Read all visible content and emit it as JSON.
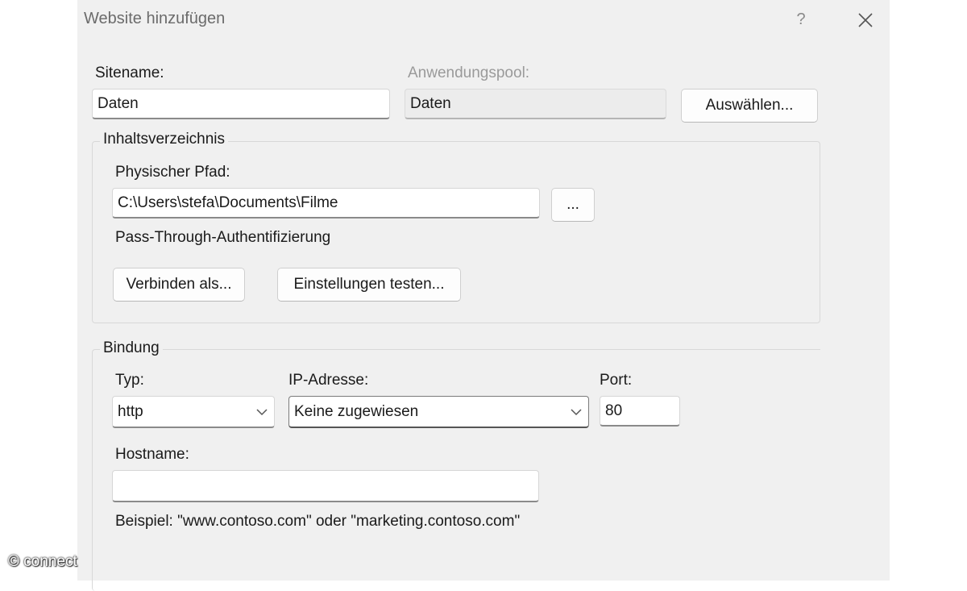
{
  "window": {
    "title": "Website hinzufügen",
    "help_label": "?",
    "close_icon": "close-icon"
  },
  "site": {
    "sitename_label": "Sitename:",
    "sitename_value": "Daten",
    "apppool_label": "Anwendungspool:",
    "apppool_value": "Daten",
    "select_button": "Auswählen..."
  },
  "content_dir": {
    "group_title": "Inhaltsverzeichnis",
    "path_label": "Physischer Pfad:",
    "path_value": "C:\\Users\\stefa\\Documents\\Filme",
    "browse_button": "...",
    "passthrough_label": "Pass-Through-Authentifizierung",
    "connect_as_button": "Verbinden als...",
    "test_settings_button": "Einstellungen testen..."
  },
  "binding": {
    "group_title": "Bindung",
    "type_label": "Typ:",
    "type_value": "http",
    "ip_label": "IP-Adresse:",
    "ip_value": "Keine zugewiesen",
    "port_label": "Port:",
    "port_value": "80",
    "hostname_label": "Hostname:",
    "hostname_value": "",
    "example_text": "Beispiel: \"www.contoso.com\" oder \"marketing.contoso.com\""
  },
  "watermark": "© connect",
  "colors": {
    "dialog_bg": "#f0f0f0",
    "disabled_text": "#9a9a9a"
  }
}
